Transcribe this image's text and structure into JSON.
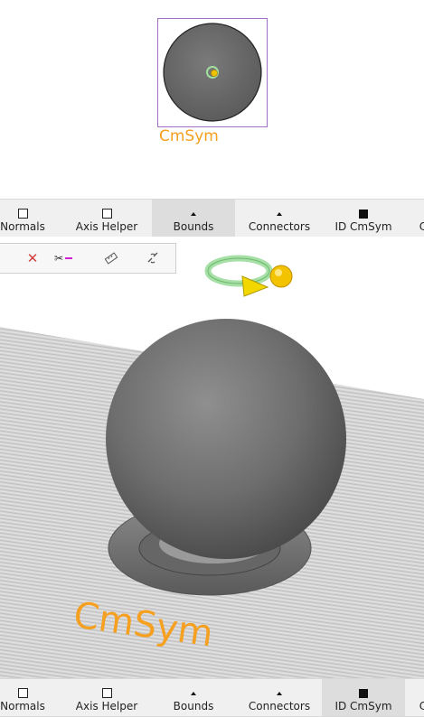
{
  "thumbnail": {
    "label": "CmSym"
  },
  "viewport": {
    "watermark": "CmSym"
  },
  "toolbar_top": {
    "items": [
      {
        "label": "Normals",
        "icon": "square-outline",
        "active": false
      },
      {
        "label": "Axis Helper",
        "icon": "square-outline",
        "active": false
      },
      {
        "label": "Bounds",
        "icon": "triangle-up",
        "active": true
      },
      {
        "label": "Connectors",
        "icon": "triangle-up",
        "active": false
      },
      {
        "label": "ID CmSym",
        "icon": "square-filled",
        "active": false
      },
      {
        "label": "C",
        "icon": "",
        "active": false
      }
    ]
  },
  "toolbar_bottom": {
    "items": [
      {
        "label": "Normals",
        "icon": "square-outline",
        "active": false
      },
      {
        "label": "Axis Helper",
        "icon": "square-outline",
        "active": false
      },
      {
        "label": "Bounds",
        "icon": "triangle-up",
        "active": false
      },
      {
        "label": "Connectors",
        "icon": "triangle-up",
        "active": false
      },
      {
        "label": "ID CmSym",
        "icon": "square-filled",
        "active": true
      },
      {
        "label": "C",
        "icon": "",
        "active": false
      }
    ]
  },
  "viewport_tools": [
    {
      "icon": "delete-x-icon"
    },
    {
      "icon": "cut-paste-icon"
    },
    {
      "icon": "ruler-icon"
    },
    {
      "icon": "link-icon"
    }
  ],
  "colors": {
    "accent": "#f5a020",
    "thumb_border": "#a070c8"
  }
}
